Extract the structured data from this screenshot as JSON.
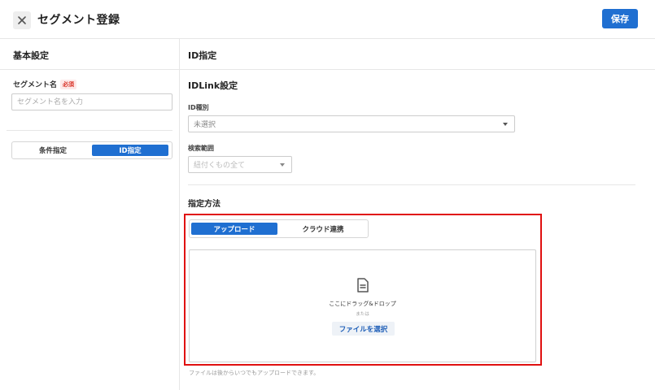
{
  "header": {
    "title": "セグメント登録",
    "save_label": "保存"
  },
  "left_panel": {
    "section_title": "基本設定",
    "segment_name_label": "セグメント名",
    "required_badge": "必須",
    "segment_name_placeholder": "セグメント名を入力",
    "segment_name_value": "",
    "mode_tabs": [
      {
        "label": "条件指定",
        "active": false
      },
      {
        "label": "ID指定",
        "active": true
      }
    ]
  },
  "right_panel": {
    "section_title": "ID指定",
    "idlink_title": "IDLink設定",
    "id_type_label": "ID種別",
    "id_type_value": "未選択",
    "search_scope_label": "検索範囲",
    "search_scope_value": "紐付くもの全て",
    "method_title": "指定方法",
    "method_tabs": [
      {
        "label": "アップロード",
        "active": true
      },
      {
        "label": "クラウド連携",
        "active": false
      }
    ],
    "dropzone": {
      "icon": "document-icon",
      "drop_text": "ここにドラッグ&ドロップ",
      "or_text": "または",
      "choose_button": "ファイルを選択"
    },
    "help_text": "ファイルは後からいつでもアップロードできます。"
  },
  "colors": {
    "primary": "#1f6fd1",
    "highlight_border": "#e01010",
    "required": "#d93025"
  }
}
